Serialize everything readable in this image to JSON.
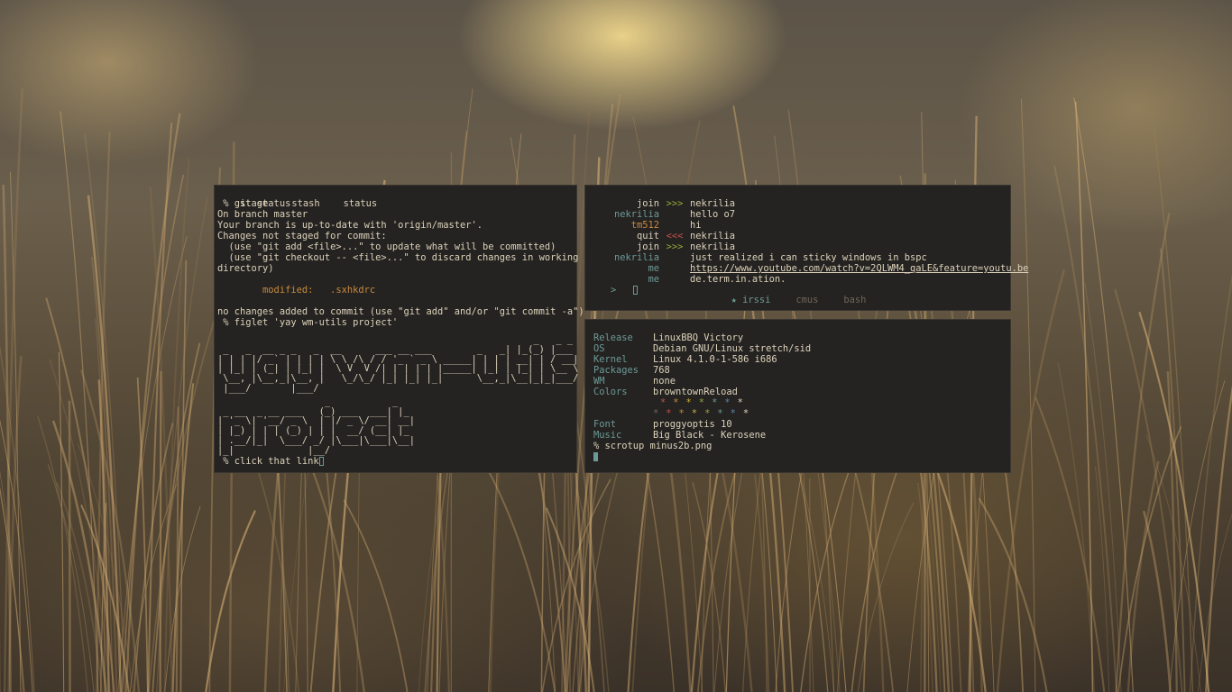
{
  "left_terminal": {
    "tabs": [
      "stage",
      "stash",
      "status"
    ],
    "lines_top": [
      " % git status",
      "On branch master",
      "Your branch is up-to-date with 'origin/master'.",
      "Changes not staged for commit:",
      "  (use \"git add <file>...\" to update what will be committed)",
      "  (use \"git checkout -- <file>...\" to discard changes in working",
      "directory)",
      ""
    ],
    "modified_label": "        modified:   ",
    "modified_file": ".sxhkdrc",
    "lines_mid": [
      "",
      "no changes added to commit (use \"git add\" and/or \"git commit -a\")",
      " % figlet 'yay wm-utils project'"
    ],
    "figlet_line1": "                                                        _   _ _\n _   _  __ _ _   _  __      ___ __ ___        _   _| |_(_) |___\n| | | |/ _` | | | | \\ \\ /\\ / / '_ ` _ \\ _____| | | | __| | / __|\n| |_| | (_| | |_| |  \\ V  V /| | | | | |_____| |_| | |_| | \\__ \\\n \\__, |\\__,_|\\__, |   \\_/\\_/ |_| |_| |_|      \\__,_|\\__|_|_|___/\n |___/       |___/",
    "figlet_line2": "                   _           _\n _ __  _ __ ___   (_) ___  ___| |_\n| '_ \\| '__/ _ \\  | |/ _ \\/ __| __|\n| |_) | | | (_) | | |  __/ (__| |_\n| .__/|_|  \\___/ _/ |\\___|\\___|\\__|\n|_|             |__/",
    "prompt": " % click that link"
  },
  "irssi": {
    "rows": [
      {
        "nick": "join",
        "arrow": ">>>",
        "msg": "nekrilia",
        "nick_color": "white",
        "arrow_color": "green"
      },
      {
        "nick": "nekrilia",
        "arrow": "",
        "msg": "hello o7",
        "nick_color": "teal"
      },
      {
        "nick": "tm512",
        "arrow": "",
        "msg": "hi",
        "nick_color": "orange"
      },
      {
        "nick": "quit",
        "arrow": "<<<",
        "msg": "nekrilia",
        "nick_color": "white",
        "arrow_color": "red"
      },
      {
        "nick": "join",
        "arrow": ">>>",
        "msg": "nekrilia",
        "nick_color": "white",
        "arrow_color": "green"
      },
      {
        "nick": "nekrilia",
        "arrow": "",
        "msg": "just realized i can sticky windows in bspc",
        "nick_color": "teal"
      },
      {
        "nick": "me",
        "arrow": "",
        "msg": "https://www.youtube.com/watch?v=2QLWM4_qaLE&feature=youtu.be",
        "nick_color": "teal",
        "link": true
      },
      {
        "nick": "me",
        "arrow": "",
        "msg": "de.term.in.ation.",
        "nick_color": "teal"
      }
    ],
    "input_prompt": ">",
    "tabs": [
      "★ irssi",
      "cmus",
      "bash"
    ]
  },
  "fetch": {
    "rows": [
      {
        "key": "Release",
        "value": "LinuxBBQ Victory"
      },
      {
        "key": "OS",
        "value": "Debian GNU/Linux stretch/sid"
      },
      {
        "key": "Kernel",
        "value": "Linux 4.1.0-1-586 i686"
      },
      {
        "key": "Packages",
        "value": "768"
      },
      {
        "key": "WM",
        "value": "none"
      },
      {
        "key": "Colors",
        "value": "browntownReload"
      }
    ],
    "star_colors_1": [
      "#c0524a",
      "#c98a3c",
      "#c9b03c",
      "#93a83a",
      "#6b9a97",
      "#5d86a8",
      "#dcd2bb"
    ],
    "star_colors_2": [
      "#6e665a",
      "#c0524a",
      "#c98a3c",
      "#c9b03c",
      "#93a83a",
      "#6b9a97",
      "#5d86a8",
      "#dcd2bb"
    ],
    "star_glyph": "*",
    "rows2": [
      {
        "key": "Font",
        "value": "proggyoptis 10"
      },
      {
        "key": "Music",
        "value": "Big Black - Kerosene"
      }
    ],
    "prompt": "% scrotup minus2b.png"
  },
  "colors": {
    "terminal_bg": "#252321",
    "foreground": "#dcd2bb",
    "accent_teal": "#6b9a97",
    "accent_orange": "#c98a3c"
  }
}
